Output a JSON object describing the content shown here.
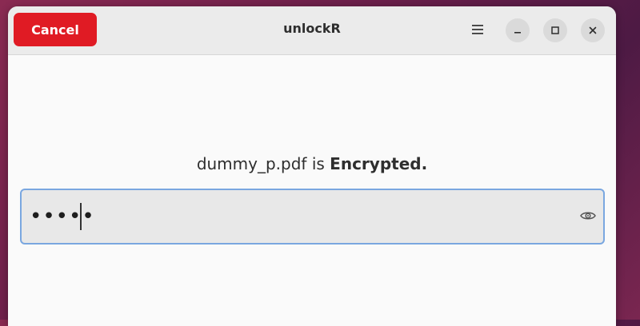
{
  "window": {
    "title": "unlockR",
    "cancel_label": "Cancel"
  },
  "message": {
    "filename": "dummy_p.pdf",
    "connector": " is ",
    "status": "Encrypted."
  },
  "password_field": {
    "masked_value": "•••••"
  },
  "icons": {
    "menu": "hamburger-menu-icon",
    "minimize": "minimize-icon",
    "maximize": "maximize-icon",
    "close": "close-icon",
    "reveal": "eye-icon"
  },
  "colors": {
    "cancel_button": "#e01b24",
    "focus_border": "#7aa7e0",
    "desktop_background": "#6a1f4a"
  }
}
